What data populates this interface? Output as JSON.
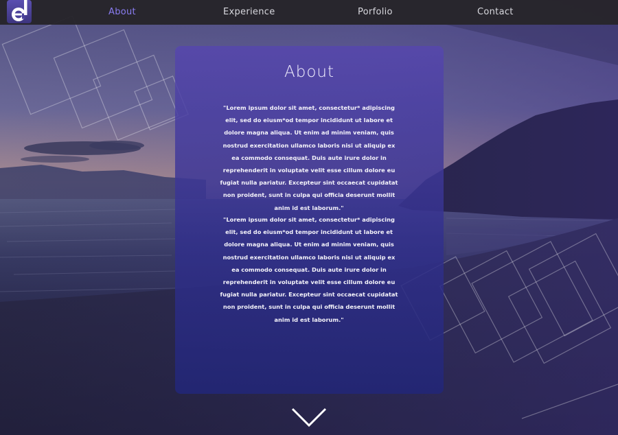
{
  "nav": {
    "logo_icon": "logo-e-icon",
    "items": [
      {
        "label": "About",
        "active": true
      },
      {
        "label": "Experience",
        "active": false
      },
      {
        "label": "Porfolio",
        "active": false
      },
      {
        "label": "Contact",
        "active": false
      }
    ],
    "active_color": "#8a7df2"
  },
  "about": {
    "title": "About",
    "paragraphs": [
      "\"Lorem ipsum dolor sit amet, consectetur* adipiscing elit, sed do eiusm*od tempor incididunt ut labore et dolore magna aliqua. Ut enim ad minim veniam, quis nostrud exercitation ullamco laboris nisi ut aliquip ex ea commodo consequat. Duis aute irure dolor in reprehenderit in voluptate velit esse cillum dolore eu fugiat nulla pariatur. Excepteur sint occaecat cupidatat non proident, sunt in culpa qui officia deserunt mollit anim id est laborum.\"",
      "\"Lorem ipsum dolor sit amet, consectetur* adipiscing elit, sed do eiusm*od tempor incididunt ut labore et dolore magna aliqua. Ut enim ad minim veniam, quis nostrud exercitation ullamco laboris nisi ut aliquip ex ea commodo consequat. Duis aute irure dolor in reprehenderit in voluptate velit esse cillum dolore eu fugiat nulla pariatur. Excepteur sint occaecat cupidatat non proident, sunt in culpa qui officia deserunt mollit anim id est laborum.\""
    ]
  },
  "scroll_icon": "chevron-down-icon",
  "colors": {
    "card_top": "#5646af",
    "card_bottom": "#222676",
    "navbar": "#26242a"
  }
}
